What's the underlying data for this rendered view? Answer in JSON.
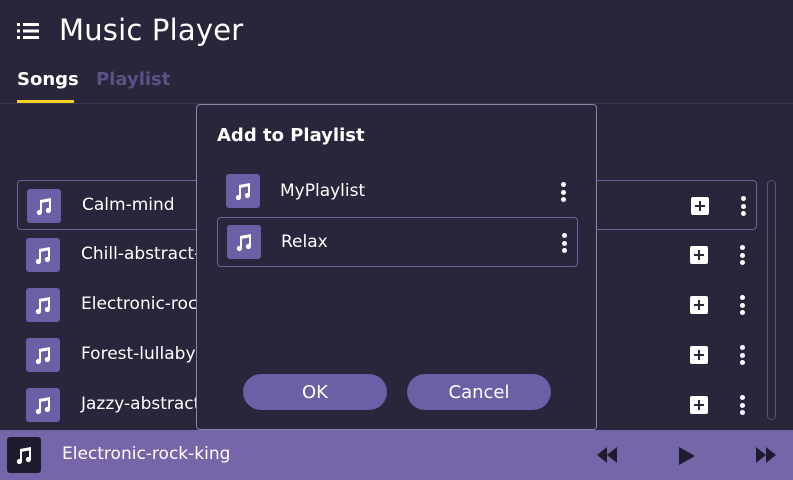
{
  "header": {
    "title": "Music Player",
    "menu_icon": "hamburger-list-icon"
  },
  "tabs": [
    {
      "label": "Songs",
      "active": true
    },
    {
      "label": "Playlist",
      "active": false
    }
  ],
  "songs": [
    {
      "title": "Calm-mind",
      "selected": true
    },
    {
      "title": "Chill-abstract-intention",
      "selected": false
    },
    {
      "title": "Electronic-rock-king",
      "selected": false
    },
    {
      "title": "Forest-lullaby",
      "selected": false
    },
    {
      "title": "Jazzy-abstract-beat",
      "selected": false
    }
  ],
  "player": {
    "now_playing": "Electronic-rock-king",
    "controls": [
      "rewind-icon",
      "play-icon",
      "fast-forward-icon"
    ]
  },
  "dialog": {
    "title": "Add to Playlist",
    "playlists": [
      {
        "label": "MyPlaylist",
        "selected": false
      },
      {
        "label": "Relax",
        "selected": true
      }
    ],
    "ok_label": "OK",
    "cancel_label": "Cancel"
  },
  "colors": {
    "background": "#29253a",
    "accent": "#6b5fa5",
    "player_bar": "#7466a8",
    "tab_underline": "#f5d020",
    "inactive_tab": "#5a5185"
  }
}
